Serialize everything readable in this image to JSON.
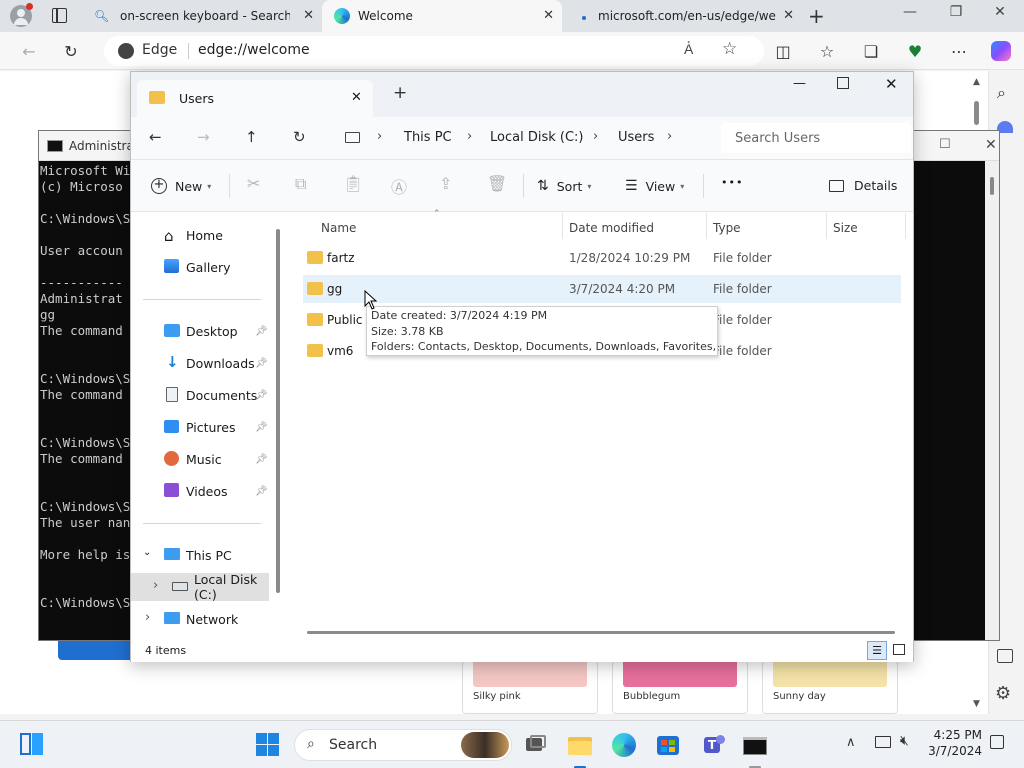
{
  "browser": {
    "tabs": [
      {
        "title": "on-screen keyboard - Search"
      },
      {
        "title": "Welcome"
      },
      {
        "title": "microsoft.com/en-us/edge/welc"
      }
    ],
    "address_label": "Edge",
    "address_url": "edge://welcome",
    "theme_cards": [
      "Silky pink",
      "Bubblegum",
      "Sunny day"
    ],
    "colors": {
      "edge_accent": "#1f6fd1",
      "silky_pink": "#f4c7c4",
      "bubblegum": "#e76f9c",
      "sunny_day": "#f3e3a8"
    }
  },
  "cmd": {
    "title": "Administrat",
    "lines": [
      "Microsoft Wi",
      "(c) Microso",
      "",
      "C:\\Windows\\S",
      "",
      "User accoun",
      "",
      "-----------",
      "Administrat",
      "gg",
      "The command",
      "",
      "",
      "C:\\Windows\\S",
      "The command",
      "",
      "",
      "C:\\Windows\\S",
      "The command",
      "",
      "",
      "C:\\Windows\\S",
      "The user nan",
      "",
      "More help is",
      "",
      "",
      "C:\\Windows\\S"
    ]
  },
  "explorer": {
    "tab_title": "Users",
    "breadcrumb": [
      "This PC",
      "Local Disk (C:)",
      "Users"
    ],
    "search_placeholder": "Search Users",
    "commands": {
      "new": "New",
      "sort": "Sort",
      "view": "View",
      "more": "•••",
      "details": "Details"
    },
    "sidebar": {
      "quick": [
        {
          "label": "Home"
        },
        {
          "label": "Gallery"
        }
      ],
      "pinned": [
        {
          "label": "Desktop"
        },
        {
          "label": "Downloads"
        },
        {
          "label": "Documents"
        },
        {
          "label": "Pictures"
        },
        {
          "label": "Music"
        },
        {
          "label": "Videos"
        }
      ],
      "this_pc": "This PC",
      "local_disk": "Local Disk (C:)",
      "network": "Network"
    },
    "columns": {
      "name": "Name",
      "date": "Date modified",
      "type": "Type",
      "size": "Size"
    },
    "rows": [
      {
        "name": "fartz",
        "date": "1/28/2024 10:29 PM",
        "type": "File folder"
      },
      {
        "name": "gg",
        "date": "3/7/2024 4:20 PM",
        "type": "File folder"
      },
      {
        "name": "Public",
        "date": "",
        "type": "File folder"
      },
      {
        "name": "vm6",
        "date": "",
        "type": "File folder"
      }
    ],
    "tooltip": {
      "created": "Date created: 3/7/2024 4:19 PM",
      "size": "Size: 3.78 KB",
      "folders": "Folders: Contacts, Desktop, Documents, Downloads, Favorites, ..."
    },
    "status": "4 items"
  },
  "taskbar": {
    "search_label": "Search",
    "time": "4:25 PM",
    "date": "3/7/2024"
  }
}
